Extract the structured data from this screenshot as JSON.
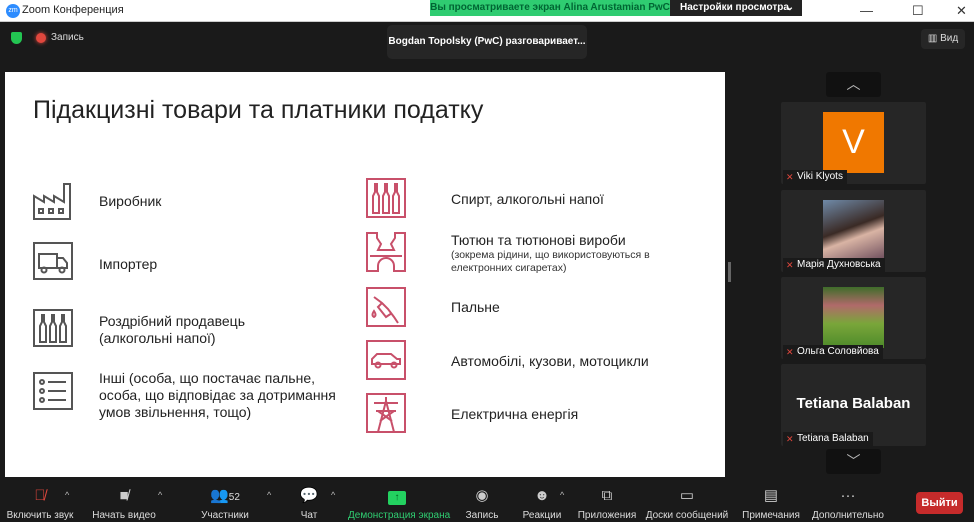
{
  "window": {
    "app_icon": "zm",
    "title": "Zoom Конференция",
    "share_banner": "Вы просматриваете экран Alina Arustamian PwC",
    "view_options": "Настройки просмотра"
  },
  "topbar": {
    "recording": "Запись",
    "speaker": "Bogdan Topolsky (PwC) разговаривает...",
    "view": "Вид"
  },
  "slide": {
    "title": "Підакцизні товари та платники податку",
    "left": [
      {
        "icon": "factory-icon",
        "text": "Виробник"
      },
      {
        "icon": "truck-icon",
        "text": "Імпортер"
      },
      {
        "icon": "bottles-icon",
        "text": "Роздрібний продавець (алкогольні напої)"
      },
      {
        "icon": "list-icon",
        "text": "Інші (особа, що постачає пальне, особа, що відповідає за дотримання умов звільнення, тощо)"
      }
    ],
    "right": [
      {
        "icon": "bottles-icon",
        "text": "Спирт, алкогольні напої",
        "sub": ""
      },
      {
        "icon": "tobacco-icon",
        "text": "Тютюн та тютюнові вироби",
        "sub": "(зокрема рідини, що використовуються в електронних сигаретах)"
      },
      {
        "icon": "fuel-nozzle-icon",
        "text": "Пальне",
        "sub": ""
      },
      {
        "icon": "car-icon",
        "text": "Автомобілі, кузови, мотоцикли",
        "sub": ""
      },
      {
        "icon": "power-tower-icon",
        "text": "Електрична енергія",
        "sub": ""
      }
    ],
    "icon_color": "#c8506a"
  },
  "participants": [
    {
      "name": "Viki Klyots",
      "avatar_letter": "V",
      "avatar_color": "#f07800"
    },
    {
      "name": "Марія Духновська"
    },
    {
      "name": "Ольга Соловйова"
    },
    {
      "name": "Tetiana Balaban",
      "display_name": "Tetiana Balaban"
    }
  ],
  "toolbar": {
    "unmute": "Включить звук",
    "start_video": "Начать видео",
    "participants": "Участники",
    "participants_count": "52",
    "chat": "Чат",
    "share": "Демонстрация экрана",
    "record": "Запись",
    "reactions": "Реакции",
    "apps": "Приложения",
    "whiteboards": "Доски сообщений",
    "notes": "Примечания",
    "more": "Дополнительно",
    "leave": "Выйти"
  }
}
